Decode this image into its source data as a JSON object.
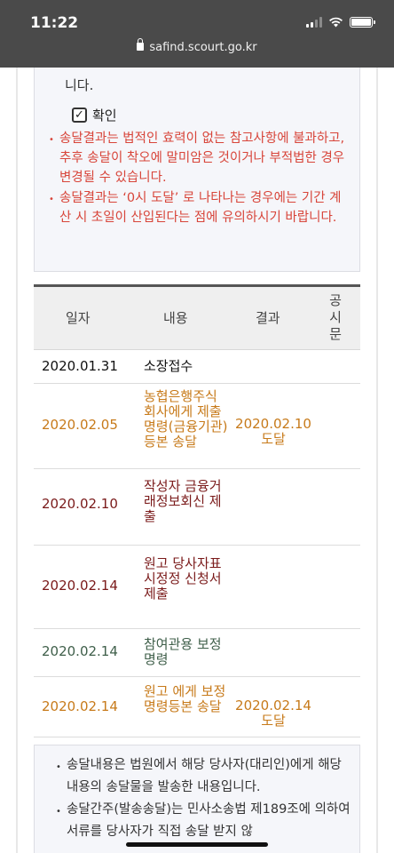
{
  "status_bar": {
    "time": "11:22"
  },
  "browser": {
    "url": "safind.scourt.go.kr"
  },
  "notice": {
    "continued_text": "니다.",
    "confirm_label": "확인",
    "items": [
      "송달결과는 법적인 효력이 없는 참고사항에 불과하고, 추후 송달이 착오에 말미암은 것이거나 부적법한 경우 변경될 수 있습니다.",
      "송달결과는 ‘0시 도달’ 로 나타나는 경우에는 기간 계산 시 초일이 산입된다는 점에 유의하시기 바랍니다."
    ]
  },
  "table": {
    "headers": {
      "date": "일자",
      "content": "내용",
      "result": "결과",
      "notice": "공시문"
    },
    "rows": [
      {
        "date": "2020.01.31",
        "content": "소장접수",
        "result": "",
        "color": "#111111"
      },
      {
        "date": "2020.02.05",
        "content": "농협은행주식회사에게 제출명령(금융기관) 등본 송달",
        "result": "2020.02.10 도달",
        "color": "#c77a1a"
      },
      {
        "date": "2020.02.10",
        "content": "작성자 금융거래정보회신 제출",
        "result": "",
        "color": "#7a1a1a"
      },
      {
        "date": "2020.02.14",
        "content": "원고 당사자표시정정 신청서 제출",
        "result": "",
        "color": "#7a1a1a"
      },
      {
        "date": "2020.02.14",
        "content": "참여관용 보정명령",
        "result": "",
        "color": "#3f5f4a"
      },
      {
        "date": "2020.02.14",
        "content": "원고 에게 보정명령등본 송달",
        "result": "2020.02.14 도달",
        "color": "#c77a1a"
      }
    ]
  },
  "info": {
    "items": [
      "송달내용은 법원에서 해당 당사자(대리인)에게 해당 내용의 송달물을 발송한 내용입니다.",
      "송달간주(발송송달)는 민사소송법 제189조에 의하여 서류를 당사자가 직접 송달 받지 않"
    ]
  }
}
